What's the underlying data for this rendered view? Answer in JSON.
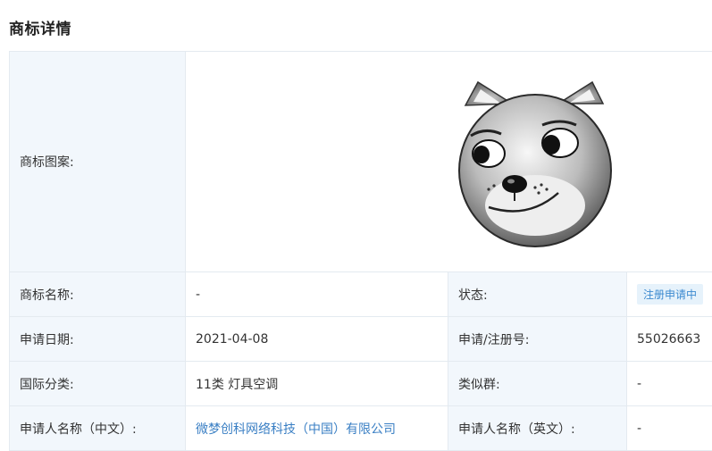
{
  "page": {
    "title": "商标详情"
  },
  "image_row": {
    "label": "商标图案:",
    "image_icon": "shiba-dog-face-logo"
  },
  "rows": [
    {
      "label1": "商标名称:",
      "value1": "-",
      "label2": "状态:",
      "value2": "注册申请中"
    },
    {
      "label1": "申请日期:",
      "value1": "2021-04-08",
      "label2": "申请/注册号:",
      "value2": "55026663"
    },
    {
      "label1": "国际分类:",
      "value1": "11类 灯具空调",
      "label2": "类似群:",
      "value2": "-"
    },
    {
      "label1": "申请人名称（中文）:",
      "value1": "微梦创科网络科技（中国）有限公司",
      "label2": "申请人名称（英文）:",
      "value2": "-"
    }
  ],
  "colors": {
    "label_bg": "#f2f7fc",
    "border": "#e4eaf0",
    "link": "#3a7fc4",
    "badge_bg": "#e6f2fb",
    "badge_text": "#3c8ad0"
  }
}
